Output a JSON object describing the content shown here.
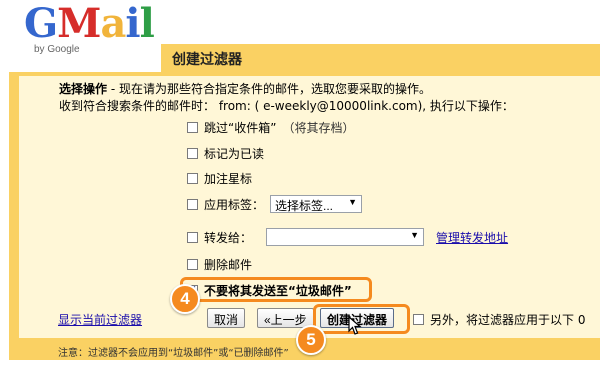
{
  "logo": {
    "word_g": "G",
    "word_m": "M",
    "word_a": "a",
    "word_i": "i",
    "word_l": "l",
    "byline": "by Google"
  },
  "header": {
    "title": "创建过滤器"
  },
  "intro": {
    "label": "选择操作",
    "text": " - 现在请为那些符合指定条件的邮件，选取您要采取的操作。",
    "line2": "收到符合搜索条件的邮件时： from: ( e-weekly@10000link.com), 执行以下操作："
  },
  "options": {
    "skip_inbox": "跳过“收件箱”",
    "skip_inbox_hint": "（将其存档）",
    "mark_read": "标记为已读",
    "star": "加注星标",
    "apply_label": "应用标签：",
    "label_select": "选择标签...",
    "forward": "转发给：",
    "forward_select": "",
    "manage_forward_link": "管理转发地址",
    "delete": "删除邮件",
    "never_spam": "不要将其发送至“垃圾邮件”"
  },
  "buttons": {
    "show_filter_link": "显示当前过滤器",
    "cancel": "取消",
    "back": "«上一步",
    "create": "创建过滤器",
    "also_apply": "另外，将过滤器应用于以下 0"
  },
  "badges": {
    "step4": "4",
    "step5": "5"
  },
  "footnote": "注意：过滤器不会应用到“垃圾邮件”或“已删除邮件”",
  "colors": {
    "accent": "#fad163",
    "panel_bg": "#fff7d7",
    "callout": "#f58a1f",
    "link": "#1a0dab"
  },
  "state": {
    "never_spam_checked": true
  }
}
